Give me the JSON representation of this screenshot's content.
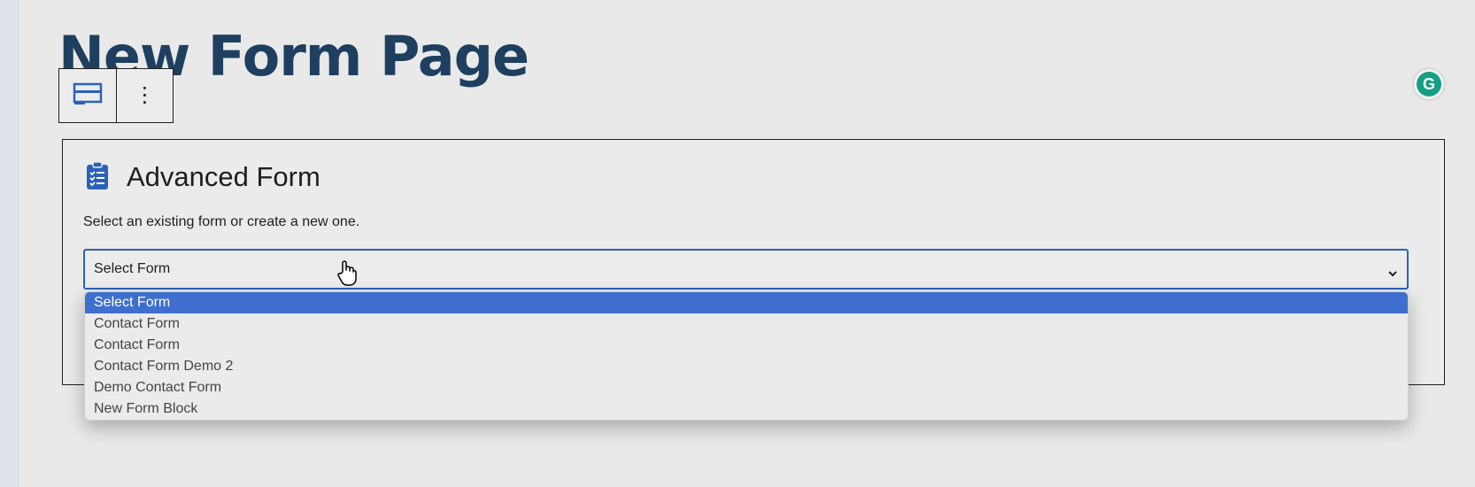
{
  "page": {
    "title": "New Form Page"
  },
  "block_toolbar": {
    "block_type_icon": "block-card-icon",
    "more_icon": "more-vertical-icon",
    "more_glyph": "⋮"
  },
  "extension": {
    "icon": "grammarly-icon",
    "letter": "G",
    "color": "#15a085"
  },
  "form_block": {
    "icon": "clipboard-list-icon",
    "heading": "Advanced Form",
    "instruction": "Select an existing form or create a new one.",
    "select": {
      "value": "Select Form",
      "options": [
        "Select Form",
        "Contact Form",
        "Contact Form",
        "Contact Form Demo 2",
        "Demo Contact Form",
        "New Form Block"
      ],
      "selected_index": 0
    }
  },
  "colors": {
    "title": "#1e3f5f",
    "accent": "#2b62b7",
    "highlight": "#3e6fce"
  }
}
